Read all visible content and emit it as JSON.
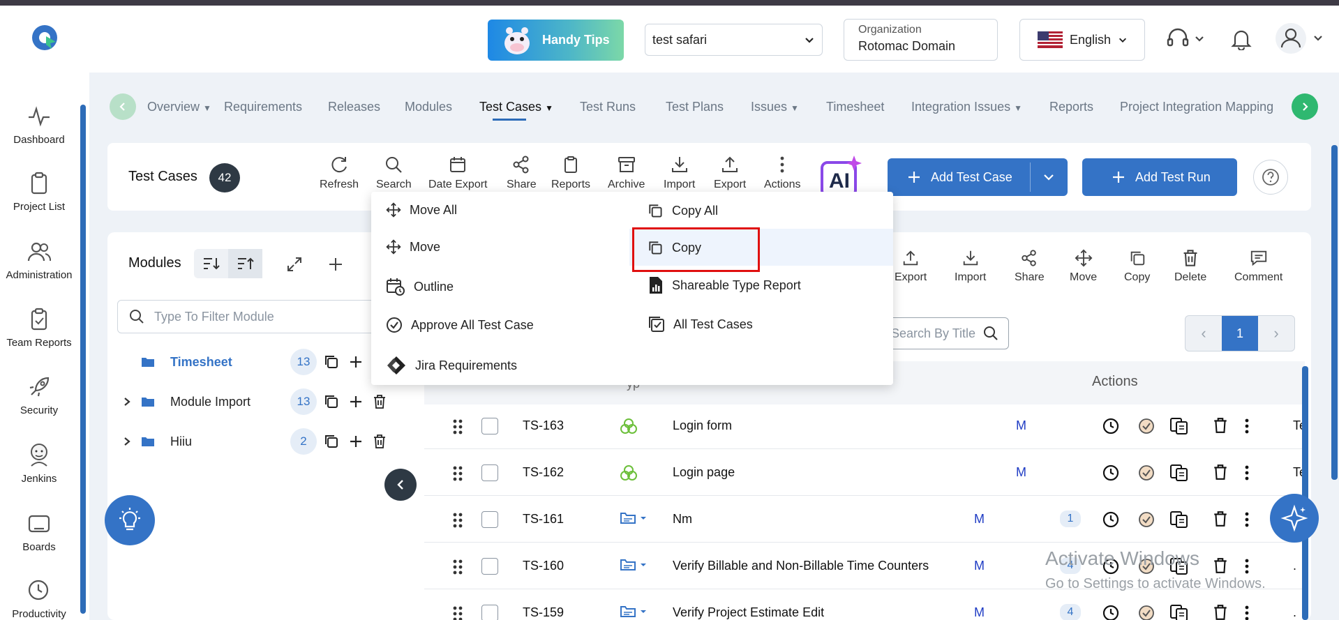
{
  "header": {
    "handy_tips": "Handy Tips",
    "project_select": "test safari",
    "org_label": "Organization",
    "org_value": "Rotomac Domain",
    "language": "English"
  },
  "sidebar": {
    "items": [
      {
        "label": "Dashboard"
      },
      {
        "label": "Project List"
      },
      {
        "label": "Administration"
      },
      {
        "label": "Team Reports"
      },
      {
        "label": "Security"
      },
      {
        "label": "Jenkins"
      },
      {
        "label": "Boards"
      },
      {
        "label": "Productivity"
      }
    ]
  },
  "nav": {
    "tabs": [
      "Overview",
      "Requirements",
      "Releases",
      "Modules",
      "Test Cases",
      "Test Runs",
      "Test Plans",
      "Issues",
      "Timesheet",
      "Integration Issues",
      "Reports",
      "Project Integration Mapping"
    ],
    "active": "Test Cases"
  },
  "toolbar": {
    "title": "Test Cases",
    "count": "42",
    "buttons": [
      "Refresh",
      "Search",
      "Date Export",
      "Share",
      "Reports",
      "Archive",
      "Import",
      "Export",
      "Actions"
    ],
    "ai_label": "AI",
    "add_test_case": "Add Test Case",
    "add_test_run": "Add Test Run"
  },
  "modules": {
    "title": "Modules",
    "filter_placeholder": "Type To Filter Module",
    "items": [
      {
        "name": "Timesheet",
        "count": "13"
      },
      {
        "name": "Module Import",
        "count": "13"
      },
      {
        "name": "Hiiu",
        "count": "2"
      }
    ]
  },
  "grid_toolbar": {
    "buttons": [
      "Export",
      "Import",
      "Share",
      "Move",
      "Copy",
      "Delete",
      "Comment"
    ],
    "search_placeholder": "Search By Title",
    "page": "1"
  },
  "table": {
    "actions_header": "Actions",
    "type_header_partial": "yp",
    "rows": [
      {
        "id": "TS-163",
        "title": "Login form",
        "m": "M",
        "count": "",
        "extra": "Te"
      },
      {
        "id": "TS-162",
        "title": "Login page",
        "m": "M",
        "count": "",
        "extra": "Te"
      },
      {
        "id": "TS-161",
        "title": "Nm",
        "m": "M",
        "count": "1",
        "extra": ""
      },
      {
        "id": "TS-160",
        "title": "Verify Billable and Non-Billable Time Counters",
        "m": "M",
        "count": "4",
        "extra": "."
      },
      {
        "id": "TS-159",
        "title": "Verify Project Estimate Edit",
        "m": "M",
        "count": "4",
        "extra": "."
      }
    ]
  },
  "actions_menu": {
    "left": [
      "Move All",
      "Move",
      "Outline",
      "Approve All Test Case",
      "Jira Requirements"
    ],
    "right": [
      "Copy All",
      "Copy",
      "Shareable Type Report",
      "All Test Cases"
    ]
  },
  "watermark": {
    "line1": "Activate Windows",
    "line2": "Go to Settings to activate Windows."
  },
  "colors": {
    "primary": "#3473c6",
    "dark": "#2e3944",
    "highlight_border": "#e01010"
  }
}
